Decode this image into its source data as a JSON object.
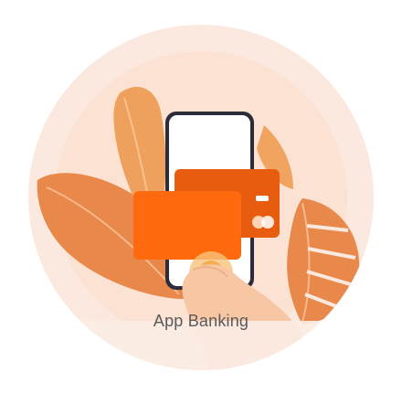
{
  "tile": {
    "label": "App Banking",
    "icon": "phone-payment-icon"
  },
  "colors": {
    "tile_background": "#fbe9df",
    "leaf_orange": "#e8894b",
    "leaf_light": "#f0a460",
    "card_front": "#ff6a0e",
    "card_back": "#e85c10",
    "phone_frame": "#2b2b3a",
    "caption_text": "#5a5a5a"
  }
}
